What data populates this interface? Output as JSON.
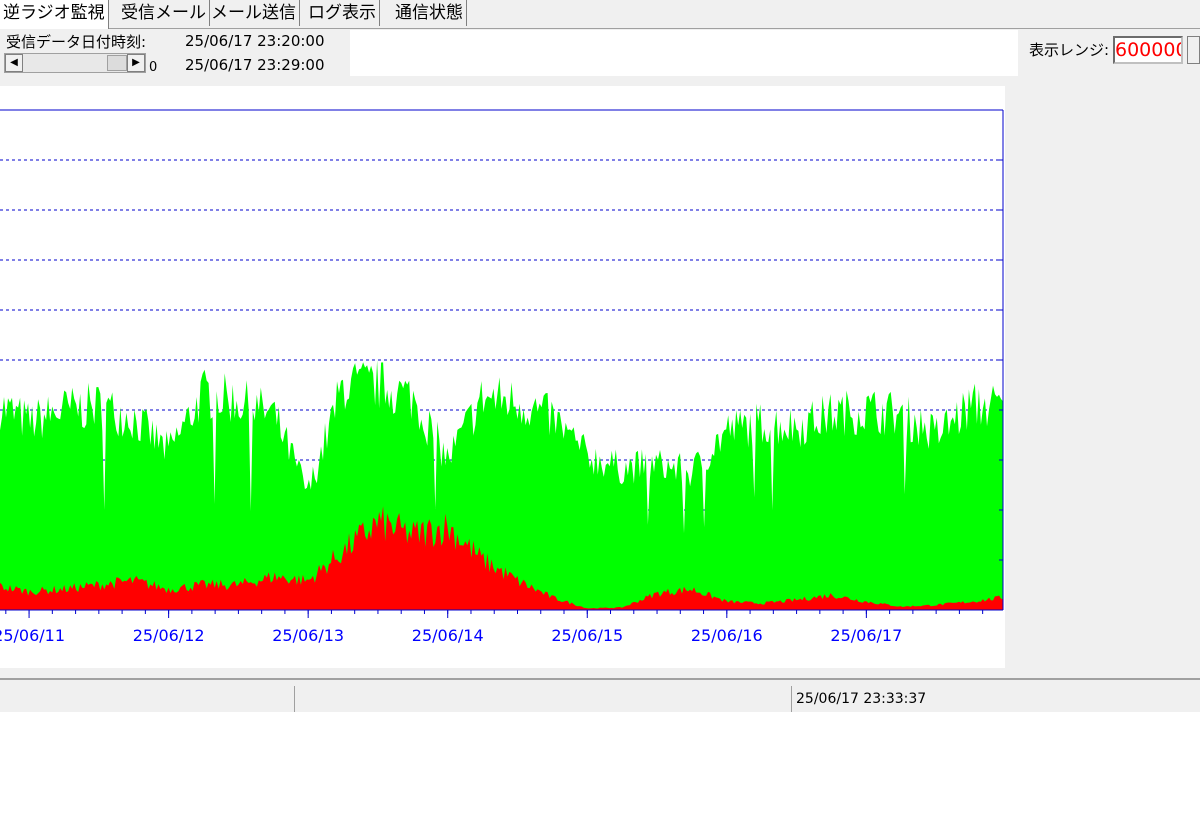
{
  "tabs": [
    {
      "label": "逆ラジオ監視",
      "active": true
    },
    {
      "label": "受信メール",
      "active": false
    },
    {
      "label": "メール送信",
      "active": false
    },
    {
      "label": "ログ表示",
      "active": false
    },
    {
      "label": "通信状態",
      "active": false
    }
  ],
  "header": {
    "receive_label": "受信データ日付時刻:",
    "time_start": "25/06/17 23:20:00",
    "time_end": "25/06/17 23:29:00",
    "scroll_value": "0",
    "range_label": "表示レンジ:",
    "range_value": "600000"
  },
  "status": {
    "datetime": "25/06/17 23:33:37"
  },
  "colors": {
    "series_total": "#00ff00",
    "series_sub": "#ff0000",
    "grid": "#0000cc",
    "axis_labels": "#0000ff"
  },
  "chart_data": {
    "type": "area",
    "x_tick_labels": [
      "25/06/11",
      "25/06/12",
      "25/06/13",
      "25/06/14",
      "25/06/15",
      "25/06/16",
      "25/06/17"
    ],
    "xlim": [
      "25/06/10 19:00",
      "25/06/17 23:30"
    ],
    "ylim": [
      0,
      600000
    ],
    "grid": true,
    "series": [
      {
        "color": "#00ff00",
        "x": [
          "25/06/10 19:00",
          "25/06/11 00:00",
          "25/06/11 06:00",
          "25/06/11 12:00",
          "25/06/11 18:00",
          "25/06/12 00:00",
          "25/06/12 06:00",
          "25/06/12 12:00",
          "25/06/12 18:00",
          "25/06/13 00:00",
          "25/06/13 06:00",
          "25/06/13 12:00",
          "25/06/13 18:00",
          "25/06/14 00:00",
          "25/06/14 06:00",
          "25/06/14 12:00",
          "25/06/14 18:00",
          "25/06/15 00:00",
          "25/06/15 06:00",
          "25/06/15 12:00",
          "25/06/15 18:00",
          "25/06/16 00:00",
          "25/06/16 06:00",
          "25/06/16 12:00",
          "25/06/16 18:00",
          "25/06/17 00:00",
          "25/06/17 06:00",
          "25/06/17 12:00",
          "25/06/17 18:00",
          "25/06/17 23:30"
        ],
        "values": [
          245000,
          225000,
          240000,
          245000,
          230000,
          190000,
          260000,
          250000,
          235000,
          140000,
          270000,
          270000,
          255000,
          180000,
          255000,
          250000,
          230000,
          185000,
          170000,
          175000,
          165000,
          215000,
          225000,
          220000,
          235000,
          240000,
          235000,
          210000,
          245000,
          245000
        ]
      },
      {
        "color": "#ff0000",
        "x": [
          "25/06/10 19:00",
          "25/06/11 00:00",
          "25/06/11 06:00",
          "25/06/11 12:00",
          "25/06/11 18:00",
          "25/06/12 00:00",
          "25/06/12 06:00",
          "25/06/12 12:00",
          "25/06/12 18:00",
          "25/06/13 00:00",
          "25/06/13 06:00",
          "25/06/13 12:00",
          "25/06/13 18:00",
          "25/06/14 00:00",
          "25/06/14 06:00",
          "25/06/14 12:00",
          "25/06/14 18:00",
          "25/06/15 00:00",
          "25/06/15 06:00",
          "25/06/15 12:00",
          "25/06/15 18:00",
          "25/06/16 00:00",
          "25/06/16 06:00",
          "25/06/16 12:00",
          "25/06/16 18:00",
          "25/06/17 00:00",
          "25/06/17 06:00",
          "25/06/17 12:00",
          "25/06/17 18:00",
          "25/06/17 23:30"
        ],
        "values": [
          28000,
          22000,
          25000,
          30000,
          35000,
          25000,
          30000,
          30000,
          40000,
          35000,
          70000,
          105000,
          90000,
          100000,
          60000,
          35000,
          15000,
          2000,
          3000,
          20000,
          25000,
          10000,
          8000,
          12000,
          18000,
          10000,
          4000,
          6000,
          10000,
          15000
        ]
      }
    ]
  }
}
